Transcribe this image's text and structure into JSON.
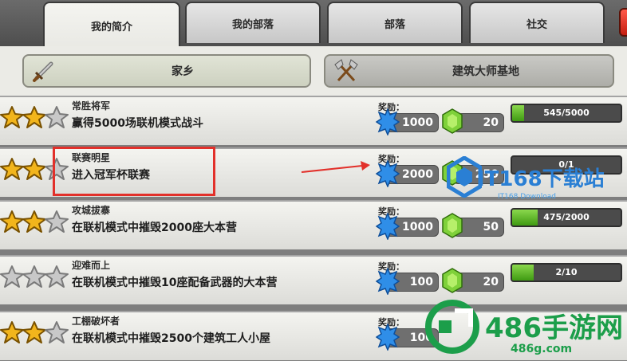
{
  "tabs": [
    {
      "label": "我的简介",
      "active": true
    },
    {
      "label": "我的部落",
      "active": false
    },
    {
      "label": "部落",
      "active": false
    },
    {
      "label": "社交",
      "active": false
    }
  ],
  "categories": {
    "home": {
      "label": "家乡",
      "icon": "sword-icon"
    },
    "builder": {
      "label": "建筑大师基地",
      "icon": "crossed-axes-icon"
    }
  },
  "reward_label": "奖励：",
  "achievements": [
    {
      "title": "常胜将军",
      "desc": "赢得5000场联机模式战斗",
      "stars": 2,
      "xp": "1000",
      "gems": "20",
      "progress": "545/5000",
      "progress_fraction": 0.109
    },
    {
      "title": "联赛明星",
      "desc": "进入冠军杯联赛",
      "stars": 2,
      "xp": "2000",
      "gems": "250",
      "progress": "0/1",
      "progress_fraction": 0
    },
    {
      "title": "攻城拔寨",
      "desc": "在联机模式中摧毁2000座大本营",
      "stars": 2,
      "xp": "1000",
      "gems": "50",
      "progress": "475/2000",
      "progress_fraction": 0.2375
    },
    {
      "title": "迎难而上",
      "desc": "在联机模式中摧毁10座配备武器的大本营",
      "stars": 0,
      "xp": "100",
      "gems": "20",
      "progress": "2/10",
      "progress_fraction": 0.2
    },
    {
      "title": "工棚破坏者",
      "desc": "在联机模式中摧毁2500个建筑工人小屋",
      "stars": 2,
      "xp": "100",
      "gems": "",
      "progress": "",
      "progress_fraction": 0
    }
  ],
  "watermarks": {
    "it168": {
      "main": "IT168下载站",
      "sub": "IT168 Download"
    },
    "site486": {
      "main": "486手游网",
      "sub": "486g.com"
    }
  },
  "colors": {
    "star_gold": "#f2b51c",
    "progress_green": "#5bb82a",
    "annotation_red": "#e2302a"
  }
}
